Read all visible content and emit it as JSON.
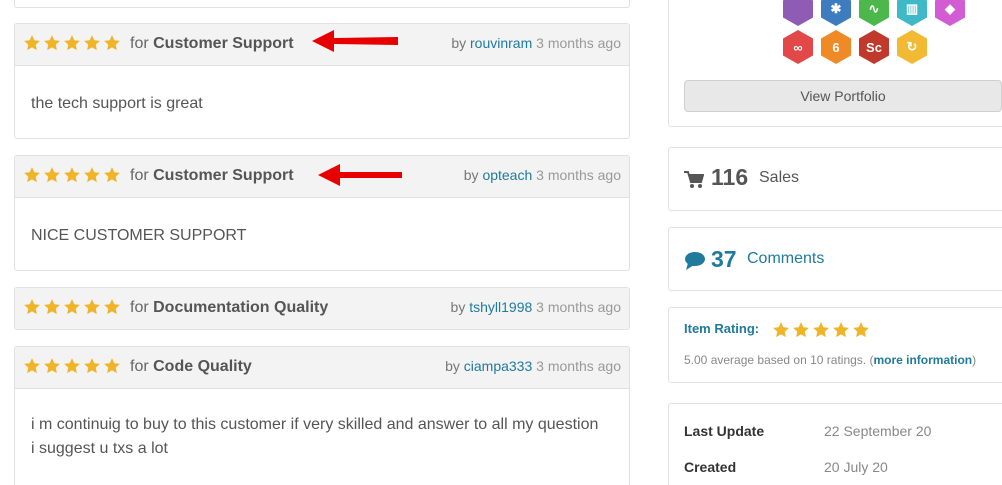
{
  "reviews": [
    {
      "category_prefix": "for",
      "category": "Customer Support",
      "by": "by",
      "author": "rouvinram",
      "when": "3 months ago",
      "body_lines": [
        "the tech support is great"
      ]
    },
    {
      "category_prefix": "for",
      "category": "Customer Support",
      "by": "by",
      "author": "opteach",
      "when": "3 months ago",
      "body_lines": [
        "NICE CUSTOMER SUPPORT"
      ]
    },
    {
      "category_prefix": "for",
      "category": "Documentation Quality",
      "by": "by",
      "author": "tshyll1998",
      "when": "3 months ago",
      "body_lines": []
    },
    {
      "category_prefix": "for",
      "category": "Code Quality",
      "by": "by",
      "author": "ciampa333",
      "when": "3 months ago",
      "body_lines": [
        "i m continuig to buy to this customer if very skilled and answer to all my question",
        "i suggest u txs a lot"
      ]
    }
  ],
  "review_stars": 5,
  "colors": {
    "star": "#f0b429",
    "link": "#1f7a9e",
    "arrow": "#e60000"
  },
  "sidebar": {
    "view_portfolio": "View Portfolio",
    "sales": {
      "count": "116",
      "label": "Sales"
    },
    "comments": {
      "count": "37",
      "label": "Comments"
    },
    "rating": {
      "title": "Item Rating:",
      "stars": 5,
      "summary": "5.00 average based on 10 ratings. (",
      "more_link": "more information",
      "close": ")"
    },
    "last_update": {
      "label": "Last Update",
      "value": "22 September 20"
    },
    "created": {
      "label": "Created",
      "value": "20 July 20"
    }
  },
  "badges": [
    {
      "icon": "mustache-icon",
      "color": "#8e5bb5",
      "glyph": ""
    },
    {
      "icon": "snowflake-icon",
      "color": "#3e7cc0",
      "glyph": "✱"
    },
    {
      "icon": "pulse-icon",
      "color": "#4cb84c",
      "glyph": "∿"
    },
    {
      "icon": "map-icon",
      "color": "#3fb8c8",
      "glyph": "▥"
    },
    {
      "icon": "gem-icon",
      "color": "#d35bd3",
      "glyph": "◆"
    },
    {
      "icon": "link-6-icon",
      "color": "#e24848",
      "glyph": "∞"
    },
    {
      "icon": "flame-6-icon",
      "color": "#f08a26",
      "glyph": "6"
    },
    {
      "icon": "sc-chip-icon",
      "color": "#c0392b",
      "glyph": "Sc"
    },
    {
      "icon": "refresh-icon",
      "color": "#f2b933",
      "glyph": "↻"
    }
  ]
}
